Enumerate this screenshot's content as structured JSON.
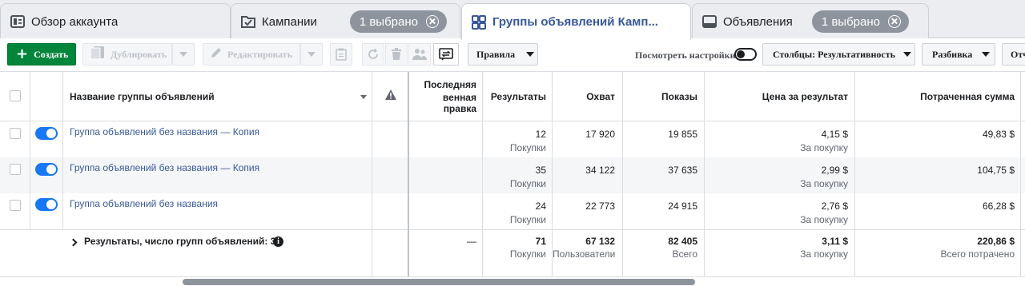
{
  "tabs": [
    {
      "label": "Обзор аккаунта",
      "icon": "account-overview-icon"
    },
    {
      "label": "Кампании",
      "icon": "campaign-folder-icon",
      "selected_badge": "1 выбрано"
    },
    {
      "label": "Группы объявлений Камп...",
      "icon": "adsets-grid-icon",
      "active": true
    },
    {
      "label": "Объявления",
      "icon": "ad-icon",
      "selected_badge": "1 выбрано"
    }
  ],
  "toolbar": {
    "create": "Создать",
    "duplicate": "Дублировать",
    "edit": "Редактировать",
    "rules": "Правила",
    "view_settings": "Посмотреть настройки",
    "columns": "Столбцы: Результативность",
    "breakdown": "Разбивка",
    "reports": "Отч"
  },
  "table": {
    "headers": {
      "name": "Название группы объявлений",
      "last_edit_line1": "Последняя",
      "last_edit_line2": "венная правка",
      "results": "Результаты",
      "reach": "Охват",
      "impressions": "Показы",
      "cost_per_result": "Цена за результат",
      "amount_spent": "Потраченная сумма"
    },
    "rows": [
      {
        "name": "Группа объявлений без названия — Копия",
        "results": "12",
        "results_sub": "Покупки",
        "reach": "17 920",
        "impressions": "19 855",
        "cpr": "4,15 $",
        "cpr_sub": "За покупку",
        "spent": "49,83 $",
        "enabled": true
      },
      {
        "name": "Группа объявлений без названия — Копия",
        "results": "35",
        "results_sub": "Покупки",
        "reach": "34 122",
        "impressions": "37 635",
        "cpr": "2,99 $",
        "cpr_sub": "За покупку",
        "spent": "104,75 $",
        "enabled": true
      },
      {
        "name": "Группа объявлений без названия",
        "results": "24",
        "results_sub": "Покупки",
        "reach": "22 773",
        "impressions": "24 915",
        "cpr": "2,76 $",
        "cpr_sub": "За покупку",
        "spent": "66,28 $",
        "enabled": true
      }
    ],
    "summary": {
      "label": "Результаты, число групп объявлений: 3",
      "last_edit": "—",
      "results": "71",
      "results_sub": "Покупки",
      "reach": "67 132",
      "reach_sub": "Пользователи",
      "impressions": "82 405",
      "impressions_sub": "Всего",
      "cpr": "3,11 $",
      "cpr_sub": "За покупку",
      "spent": "220,86 $",
      "spent_sub": "Всего потрачено"
    }
  },
  "colors": {
    "accent_blue": "#1877f2",
    "create_green": "#00853b",
    "link": "#385898",
    "badge_gray": "#8d949e"
  }
}
